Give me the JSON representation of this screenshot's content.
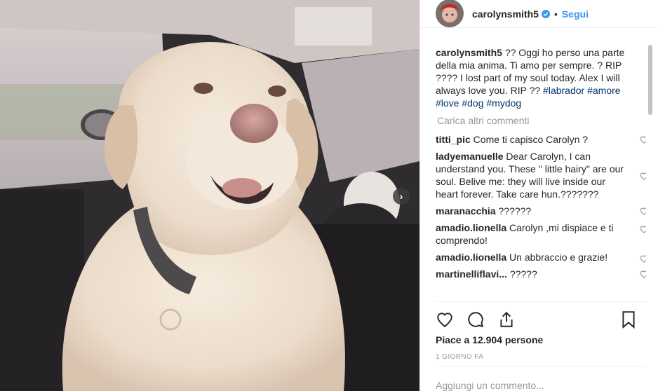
{
  "post": {
    "username": "carolynsmith5",
    "follow_label": "Segui",
    "separator": "•"
  },
  "comments": {
    "caption": {
      "user": "carolynsmith5",
      "text": "?? Oggi ho perso una parte della mia anima. Ti amo per sempre. ? RIP ???? I lost part of my soul today. Alex I will always love you. RIP ??",
      "tags": "#labrador #amore #love #dog #mydog"
    },
    "load_more": "Carica altri commenti",
    "items": [
      {
        "user": "titti_pic",
        "text": "Come ti capisco Carolyn ?"
      },
      {
        "user": "ladyemanuelle",
        "text": "Dear Carolyn, I can understand you. These \" little hairy\" are our soul. Belive me: they will live inside our heart forever. Take care hun.???????"
      },
      {
        "user": "maranacchia",
        "text": "??????"
      },
      {
        "user": "amadio.lionella",
        "text": "Carolyn ,mi dispiace e ti comprendo!"
      },
      {
        "user": "amadio.lionella",
        "text": "Un abbraccio e grazie!"
      },
      {
        "user": "martinelliflavi...",
        "text": "?????"
      }
    ]
  },
  "likes_text": "Piace a 12.904 persone",
  "time_text": "1 GIORNO FA",
  "add_comment_placeholder": "Aggiungi un commento...",
  "colors": {
    "link": "#3897f0",
    "hashtag": "#003569",
    "muted": "#999999"
  }
}
